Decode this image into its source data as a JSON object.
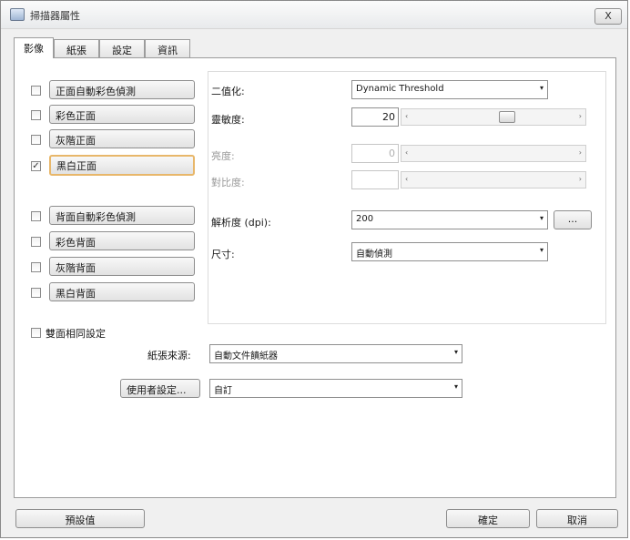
{
  "window": {
    "title": "掃描器屬性",
    "close_label": "X"
  },
  "tabs": [
    {
      "label": "影像"
    },
    {
      "label": "紙張"
    },
    {
      "label": "設定"
    },
    {
      "label": "資訊"
    }
  ],
  "active_tab": 0,
  "image_types": [
    {
      "label": "正面自動彩色偵測",
      "checked": false
    },
    {
      "label": "彩色正面",
      "checked": false
    },
    {
      "label": "灰階正面",
      "checked": false
    },
    {
      "label": "黑白正面",
      "checked": true,
      "selected": true
    },
    {
      "label": "背面自動彩色偵測",
      "checked": false
    },
    {
      "label": "彩色背面",
      "checked": false
    },
    {
      "label": "灰階背面",
      "checked": false
    },
    {
      "label": "黑白背面",
      "checked": false
    }
  ],
  "settings": {
    "binarization": {
      "label": "二值化:",
      "value": "Dynamic Threshold"
    },
    "sensitivity": {
      "label": "靈敏度:",
      "value": "20",
      "level_percent": 60
    },
    "brightness": {
      "label": "亮度:",
      "value": "0",
      "disabled": true
    },
    "contrast": {
      "label": "對比度:",
      "value": "",
      "disabled": true
    },
    "resolution": {
      "label": "解析度 (dpi):",
      "value": "200",
      "more_label": "..."
    },
    "size": {
      "label": "尺寸:",
      "value": "自動偵測"
    }
  },
  "duplex_same_settings": {
    "label": "雙面相同設定",
    "checked": false
  },
  "paper_source": {
    "label": "紙張來源:",
    "value": "自動文件饋紙器"
  },
  "user_settings": {
    "button_label": "使用者設定...",
    "value": "自訂"
  },
  "footer": {
    "default_label": "預設值",
    "ok_label": "確定",
    "cancel_label": "取消"
  },
  "icons": {
    "arrow": "▾",
    "left": "‹",
    "right": "›",
    "check": "✓"
  }
}
